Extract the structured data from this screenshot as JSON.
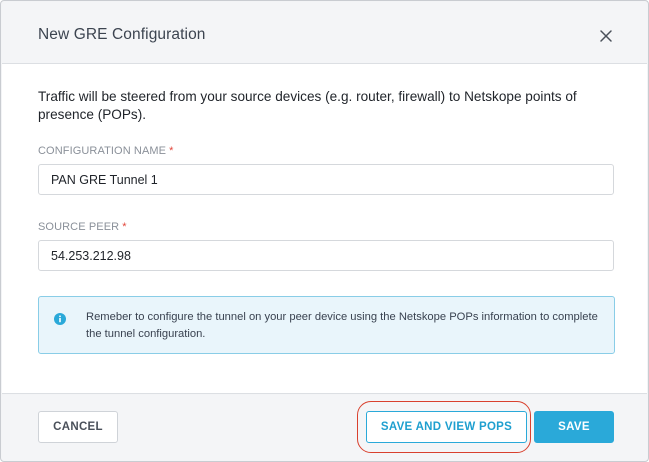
{
  "dialog": {
    "title": "New GRE Configuration",
    "close_icon": "close-icon"
  },
  "intro_text": "Traffic will be steered from your source devices (e.g. router, firewall) to Netskope points of presence (POPs).",
  "fields": {
    "config_name": {
      "label": "CONFIGURATION NAME",
      "required_mark": "*",
      "value": "PAN GRE Tunnel 1"
    },
    "source_peer": {
      "label": "SOURCE PEER",
      "required_mark": "*",
      "value": "54.253.212.98"
    }
  },
  "info": {
    "icon": "info-icon",
    "text": "Remeber to configure the tunnel on your peer device using the Netskope POPs information to complete the tunnel configuration."
  },
  "footer": {
    "cancel_label": "CANCEL",
    "save_and_view_label": "SAVE AND VIEW POPS",
    "save_label": "SAVE"
  },
  "colors": {
    "accent": "#2aa9d9",
    "required": "#e2463b",
    "highlight": "#d9412e",
    "info_bg": "#e9f5fb"
  }
}
